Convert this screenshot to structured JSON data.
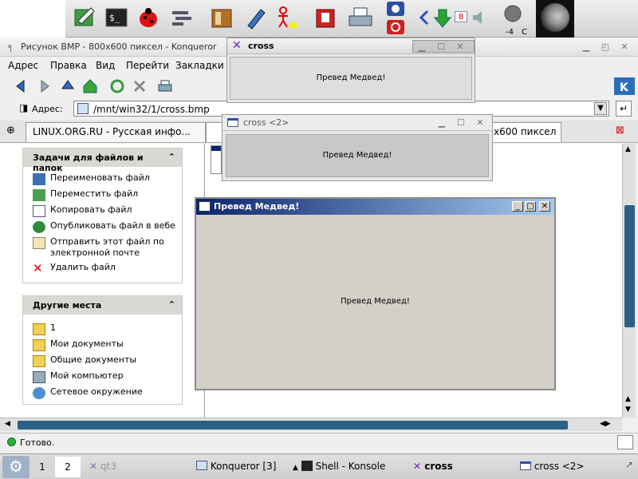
{
  "konqueror": {
    "window_title": "Рисунок BMP - 800x600 пиксел - Konqueror",
    "menu": [
      "Адрес",
      "Правка",
      "Вид",
      "Перейти",
      "Закладки"
    ],
    "location_label": "Адрес:",
    "location_value": "/mnt/win32/1/cross.bmp",
    "tabs": [
      "LINUX.ORG.RU - Русская инфо...",
      "x600 пиксел"
    ],
    "status": "Готово."
  },
  "sidebar": {
    "tasks_title": "Задачи для файлов и папок",
    "tasks": [
      "Переименовать файл",
      "Переместить файл",
      "Копировать файл",
      "Опубликовать файл в вебе",
      "Отправить этот файл по электронной почте",
      "Удалить файл"
    ],
    "places_title": "Другие места",
    "places": [
      "1",
      "Мои документы",
      "Общие документы",
      "Мой компьютер",
      "Сетевое окружение"
    ]
  },
  "windows": {
    "cross": {
      "title": "cross",
      "body": "Превед Медвед!"
    },
    "cross2": {
      "title": "cross <2>",
      "body": "Превед Медвед!"
    },
    "medved": {
      "title": "Превед Медвед!",
      "body": "Превед Медвед!"
    }
  },
  "top_panel": {
    "badge_count": "8",
    "temp_value": "-4",
    "temp_unit": "C"
  },
  "taskbar": {
    "desktops": [
      "1",
      "2"
    ],
    "tasks": [
      "qt3",
      "Konqueror [3]",
      "Shell - Konsole",
      "cross",
      "cross <2>"
    ]
  }
}
